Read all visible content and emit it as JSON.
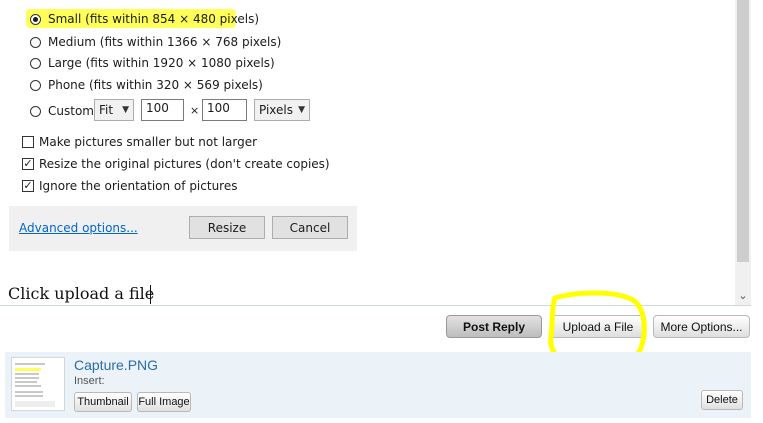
{
  "resize_dialog": {
    "options": [
      {
        "label": "Small (fits within 854 × 480 pixels)",
        "checked": true
      },
      {
        "label": "Medium (fits within 1366 × 768 pixels)",
        "checked": false
      },
      {
        "label": "Large (fits within 1920 × 1080 pixels)",
        "checked": false
      },
      {
        "label": "Phone (fits within 320 × 569 pixels)",
        "checked": false
      },
      {
        "label": "Custom",
        "checked": false
      }
    ],
    "custom": {
      "mode": "Fit",
      "width": "100",
      "times": "×",
      "height": "100",
      "unit": "Pixels"
    },
    "checkboxes": [
      {
        "label": "Make pictures smaller but not larger",
        "checked": false
      },
      {
        "label": "Resize the original pictures (don't create copies)",
        "checked": true
      },
      {
        "label": "Ignore the orientation of pictures",
        "checked": true
      }
    ],
    "advanced_link": "Advanced options...",
    "resize_button": "Resize",
    "cancel_button": "Cancel"
  },
  "editor": {
    "text": "Click upload a file"
  },
  "actions": {
    "post_reply": "Post Reply",
    "upload_file": "Upload a File",
    "more_options": "More Options..."
  },
  "attachment": {
    "filename": "Capture.PNG",
    "insert_label": "Insert:",
    "thumbnail_button": "Thumbnail",
    "full_image_button": "Full Image",
    "delete_button": "Delete"
  },
  "colors": {
    "highlight": "#ffff5a",
    "annotation": "#ffff00",
    "link": "#0066cc",
    "attachment_bg": "#ebf2f8"
  }
}
